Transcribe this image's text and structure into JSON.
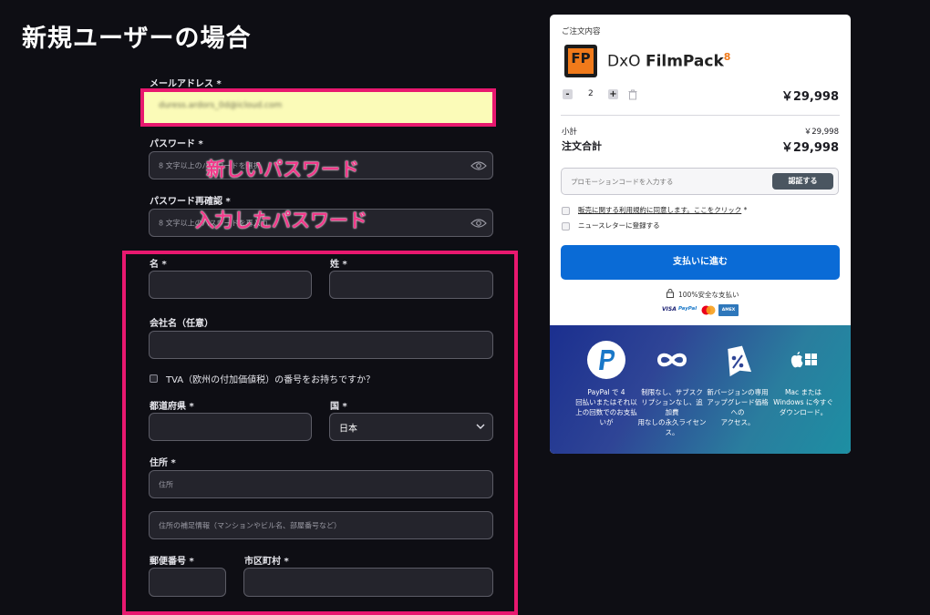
{
  "page_title": "新規ユーザーの場合",
  "form": {
    "email_label": "メールアドレス *",
    "email_value": "duress.ardors_0d@icloud.com",
    "password_label": "パスワード *",
    "password_placeholder": "8 文字以上のパスワードを選択",
    "password_confirm_label": "パスワード再確認 *",
    "password_confirm_placeholder": "8 文字以上のパスワードを再入力",
    "first_name_label": "名 *",
    "last_name_label": "姓 *",
    "company_label": "会社名（任意）",
    "tva_label": "TVA（欧州の付加価値税）の番号をお持ちですか？",
    "prefecture_label": "都道府県 *",
    "country_label": "国 *",
    "country_value": "日本",
    "address_label": "住所 *",
    "address_placeholder": "住所",
    "address2_placeholder": "住所の補足情報（マンションやビル名、部屋番号など）",
    "postal_label": "郵便番号 *",
    "city_label": "市区町村 *"
  },
  "annotations": {
    "new_password": "新しいパスワード",
    "entered_password": "入力したパスワード"
  },
  "order": {
    "header": "ご注文内容",
    "logo_text": "FP",
    "product_prefix": "DxO",
    "product_name": "FilmPack",
    "product_version": "8",
    "minus": "-",
    "quantity": "2",
    "plus": "+",
    "price": "￥29,998",
    "subtotal_label": "小計",
    "subtotal_value": "￥29,998",
    "total_label": "注文合計",
    "total_value": "￥29,998",
    "promo_placeholder": "プロモーションコードを入力する",
    "promo_button": "認証する",
    "terms_text": "販売に関する利用規約に同意します。ここをクリック",
    "terms_star": "*",
    "newsletter_text": "ニュースレターに登録する",
    "pay_button": "支払いに進む",
    "secure_text": "100%安全な支払い",
    "pay_visa": "VISA",
    "pay_paypal": "PayPal",
    "pay_amex": "AMEX"
  },
  "features": [
    {
      "icon": "paypal-icon",
      "line1": "PayPal で 4",
      "line2": "回払いまたはそれ以",
      "line3": "上の回数でのお支払",
      "line4": "いが"
    },
    {
      "icon": "infinity-icon",
      "line1": "制限なし、サブスク",
      "line2": "リプションなし、追",
      "line3": "加費",
      "line4": "用なしの永久ライセン",
      "line5": "ス。"
    },
    {
      "icon": "discount-tag-icon",
      "line1": "新バージョンの専用",
      "line2": "アップグレード価格",
      "line3": "への",
      "line4": "アクセス。"
    },
    {
      "icon": "apple-windows-icon",
      "line1": "Mac または",
      "line2": "Windows に今すぐ",
      "line3": "ダウンロード。"
    }
  ],
  "colors": {
    "highlight_border": "#e8186f",
    "pay_button": "#0a6bd6",
    "logo_orange": "#f07a1a"
  }
}
